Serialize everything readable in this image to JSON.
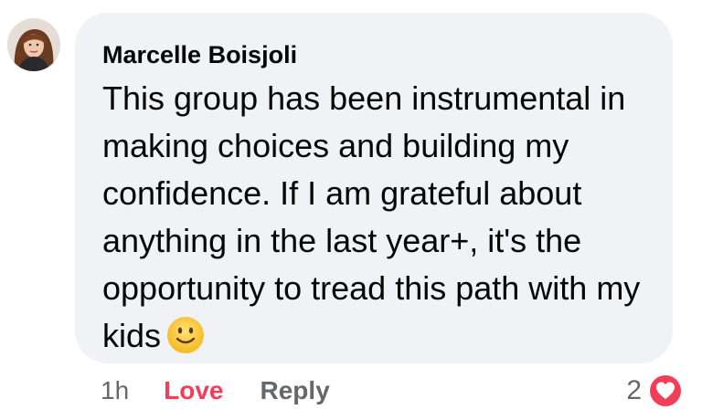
{
  "comment": {
    "author": "Marcelle Boisjoli",
    "text": "This group has been instrumental in making choices and building my confidence. If I am grateful about anything in the last year+, it's the opportunity to tread this path with my kids",
    "emoji": "slightly-smiling-face-icon"
  },
  "actions": {
    "time": "1h",
    "love_label": "Love",
    "reply_label": "Reply"
  },
  "reactions": {
    "count": "2",
    "icon": "love-reaction-icon",
    "color": "#f33e58"
  },
  "colors": {
    "bubble": "#f0f2f5",
    "text": "#050505",
    "muted": "#65676b",
    "love": "#f33e58"
  }
}
